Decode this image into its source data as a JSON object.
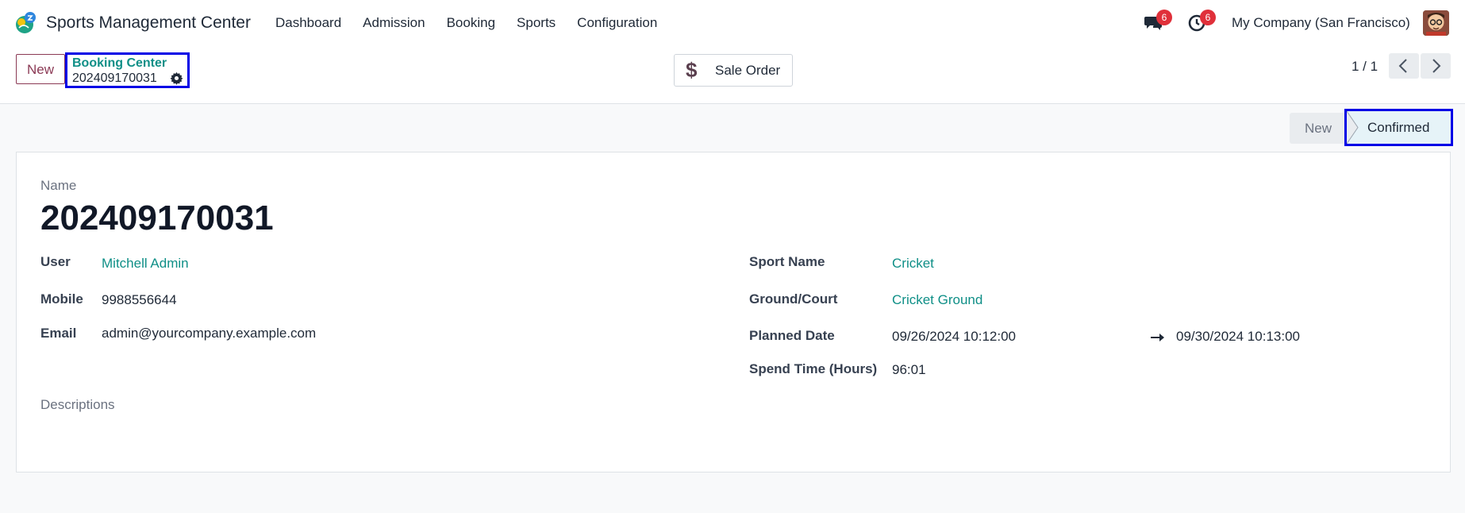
{
  "navbar": {
    "app_name": "Sports Management Center",
    "menu": [
      "Dashboard",
      "Admission",
      "Booking",
      "Sports",
      "Configuration"
    ],
    "messages_count": "6",
    "activities_count": "6",
    "company": "My Company (San Francisco)"
  },
  "control_panel": {
    "new_label": "New",
    "breadcrumb_parent": "Booking Center",
    "breadcrumb_current": "202409170031",
    "smart_button_label": "Sale Order",
    "pager": "1 / 1"
  },
  "statusbar": {
    "stages": [
      "New",
      "Confirmed"
    ],
    "active": "Confirmed"
  },
  "form": {
    "name_label": "Name",
    "name_value": "202409170031",
    "user_label": "User",
    "user_value": "Mitchell Admin",
    "mobile_label": "Mobile",
    "mobile_value": "9988556644",
    "email_label": "Email",
    "email_value": "admin@yourcompany.example.com",
    "sport_label": "Sport Name",
    "sport_value": "Cricket",
    "ground_label": "Ground/Court",
    "ground_value": "Cricket Ground",
    "planned_label": "Planned Date",
    "planned_start": "09/26/2024 10:12:00",
    "planned_end": "09/30/2024 10:13:00",
    "spend_label": "Spend Time (Hours)",
    "spend_value": "96:01",
    "descriptions_label": "Descriptions"
  },
  "colors": {
    "accent": "#0f8f87",
    "brand": "#8b3a55",
    "highlight_border": "#0000e6",
    "badge": "#e0303a"
  },
  "icons": [
    "app-logo-icon",
    "chat-icon",
    "clock-icon",
    "gear-icon",
    "dollar-icon",
    "chevron-left-icon",
    "chevron-right-icon",
    "long-arrow-right-icon"
  ]
}
